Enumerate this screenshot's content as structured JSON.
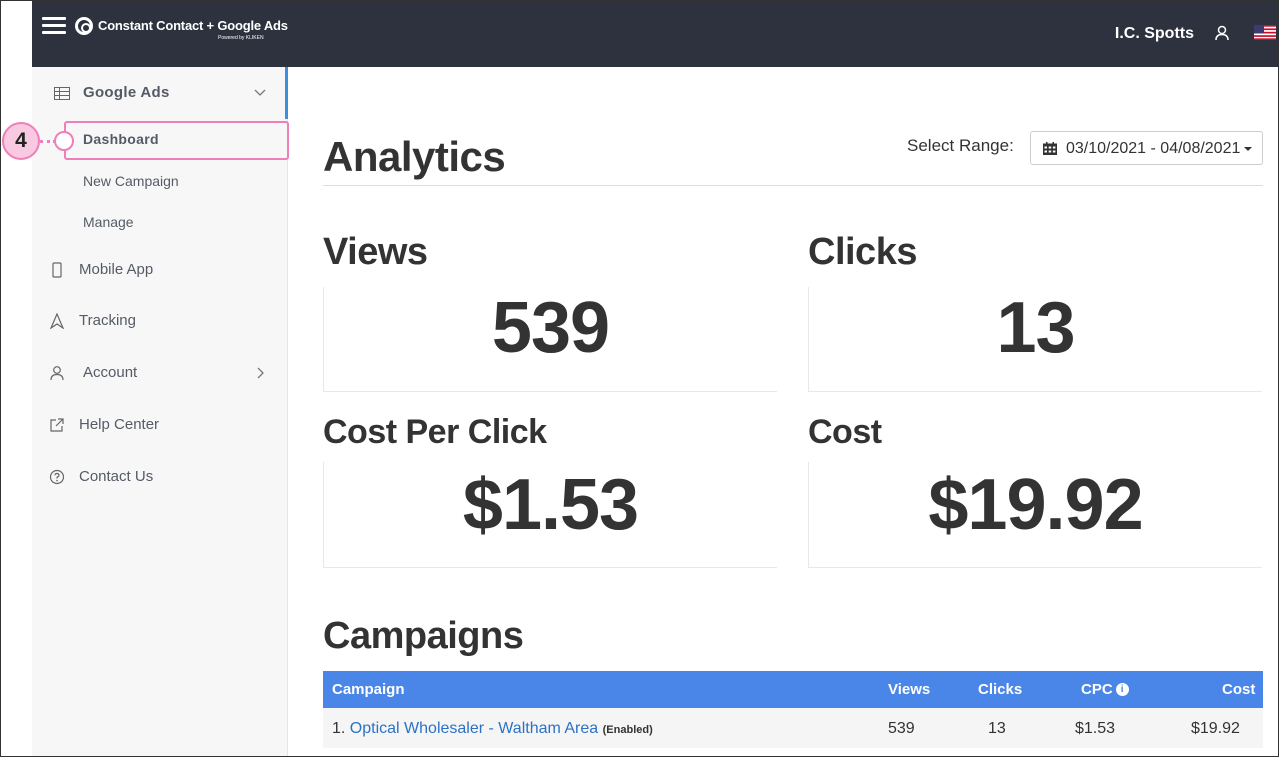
{
  "header": {
    "brand": "Constant Contact + Google Ads",
    "brand_sub": "Powered by KLIKEN",
    "user_name": "I.C. Spotts",
    "icons": [
      "menu-icon",
      "user-icon",
      "us-flag-icon"
    ]
  },
  "sidebar": {
    "group_label": "Google Ads",
    "sub_items": [
      {
        "label": "Dashboard",
        "active": true
      },
      {
        "label": "New Campaign",
        "active": false
      },
      {
        "label": "Manage",
        "active": false
      }
    ],
    "items": [
      {
        "label": "Mobile App",
        "icon": "mobile-icon"
      },
      {
        "label": "Tracking",
        "icon": "tracking-icon"
      },
      {
        "label": "Account",
        "icon": "user-icon"
      },
      {
        "label": "Help Center",
        "icon": "external-link-icon"
      },
      {
        "label": "Contact Us",
        "icon": "question-circle-icon"
      }
    ]
  },
  "callout": {
    "number": "4",
    "color": "#ee7fb8"
  },
  "main": {
    "title": "Analytics",
    "range_label": "Select Range:",
    "range_value": "03/10/2021 - 04/08/2021",
    "metrics": [
      {
        "label": "Views",
        "value": "539"
      },
      {
        "label": "Clicks",
        "value": "13"
      },
      {
        "label": "Cost Per Click",
        "value": "$1.53"
      },
      {
        "label": "Cost",
        "value": "$19.92"
      }
    ],
    "campaigns_title": "Campaigns",
    "table": {
      "headers": [
        "Campaign",
        "Views",
        "Clicks",
        "CPC",
        "Cost"
      ],
      "rows": [
        {
          "index": "1.",
          "name": "Optical Wholesaler - Waltham Area",
          "status": "(Enabled)",
          "views": "539",
          "clicks": "13",
          "cpc": "$1.53",
          "cost": "$19.92"
        }
      ]
    }
  },
  "colors": {
    "topbar": "#2d323e",
    "accent": "#3d8fdc",
    "table_header": "#4a86e8",
    "link": "#2b72c7"
  }
}
